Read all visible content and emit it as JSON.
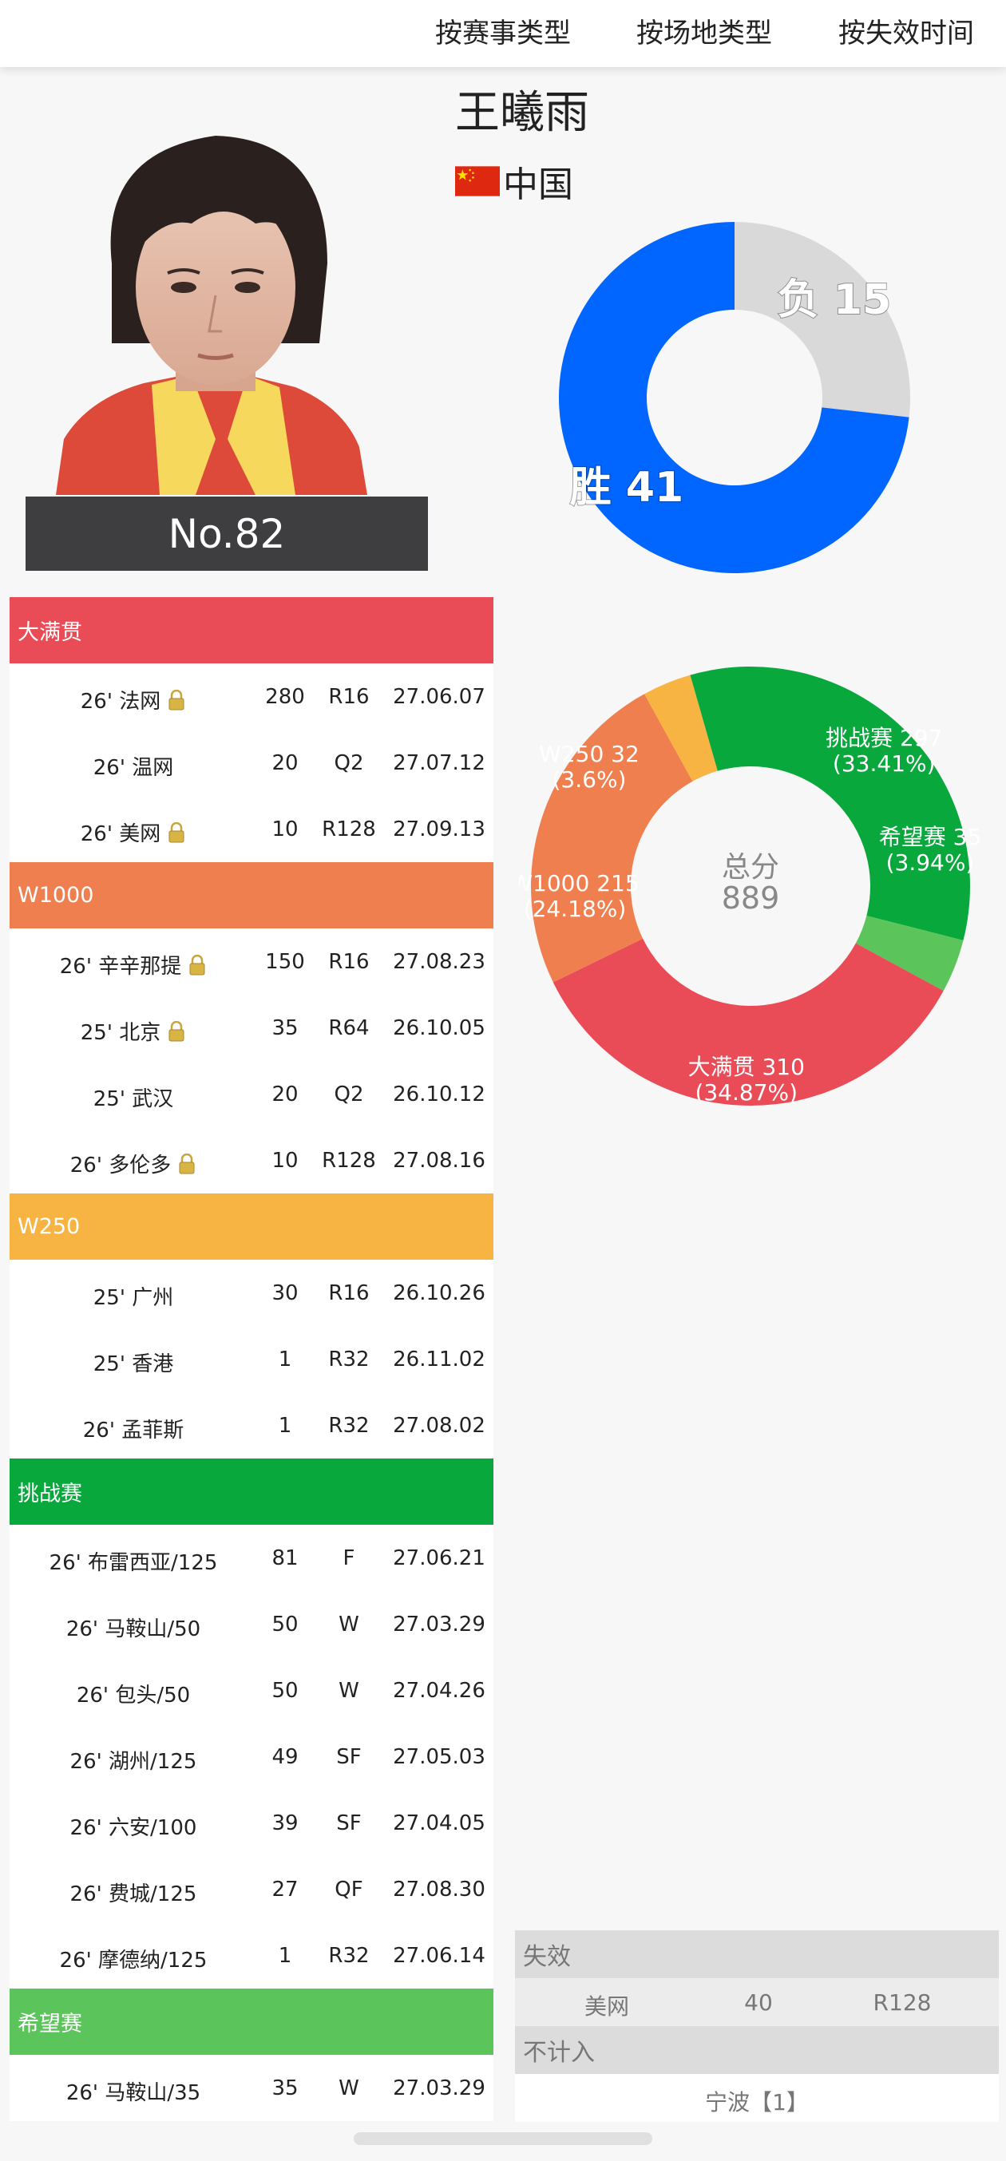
{
  "tabs": [
    "按赛事类型",
    "按场地类型",
    "按失效时间"
  ],
  "player": {
    "name": "王曦雨",
    "country": "中国",
    "rank": "No.82"
  },
  "win_loss": {
    "loss_label": "负 15",
    "win_label": "胜 41",
    "wins": 41,
    "losses": 15,
    "win_color": "#0066ff",
    "loss_color": "#d9d9d9"
  },
  "points_total": {
    "label": "总分",
    "value": "889"
  },
  "chart_data": [
    {
      "type": "pie",
      "categories": [
        "胜",
        "负"
      ],
      "values": [
        41,
        15
      ],
      "colors": [
        "#0066ff",
        "#d9d9d9"
      ]
    },
    {
      "type": "pie",
      "categories": [
        "挑战赛",
        "希望赛",
        "大满贯",
        "W1000",
        "W250"
      ],
      "values": [
        297,
        35,
        310,
        215,
        32
      ],
      "percent_labels": [
        "(33.41%)",
        "(3.94%)",
        "(34.87%)",
        "(24.18%)",
        "(3.6%)"
      ],
      "value_labels": [
        "挑战赛 297",
        "希望赛 35",
        "大满贯 310",
        "W1000 215",
        "W250 32"
      ],
      "colors": [
        "#09a83d",
        "#5bc45b",
        "#e94b57",
        "#f07f50",
        "#f8b442"
      ],
      "center_label": "总分",
      "center_value": "889"
    }
  ],
  "categories": [
    {
      "name": "大满贯",
      "color": "#e94b57",
      "rows": [
        {
          "event": "26' 法网",
          "locked": true,
          "points": "280",
          "round": "R16",
          "date": "27.06.07"
        },
        {
          "event": "26' 温网",
          "locked": false,
          "points": "20",
          "round": "Q2",
          "date": "27.07.12"
        },
        {
          "event": "26' 美网",
          "locked": true,
          "points": "10",
          "round": "R128",
          "date": "27.09.13"
        }
      ]
    },
    {
      "name": "W1000",
      "color": "#f07f50",
      "rows": [
        {
          "event": "26' 辛辛那提",
          "locked": true,
          "points": "150",
          "round": "R16",
          "date": "27.08.23"
        },
        {
          "event": "25' 北京",
          "locked": true,
          "points": "35",
          "round": "R64",
          "date": "26.10.05"
        },
        {
          "event": "25' 武汉",
          "locked": false,
          "points": "20",
          "round": "Q2",
          "date": "26.10.12"
        },
        {
          "event": "26' 多伦多",
          "locked": true,
          "points": "10",
          "round": "R128",
          "date": "27.08.16"
        }
      ]
    },
    {
      "name": "W250",
      "color": "#f8b442",
      "rows": [
        {
          "event": "25' 广州",
          "locked": false,
          "points": "30",
          "round": "R16",
          "date": "26.10.26"
        },
        {
          "event": "25' 香港",
          "locked": false,
          "points": "1",
          "round": "R32",
          "date": "26.11.02"
        },
        {
          "event": "26' 孟菲斯",
          "locked": false,
          "points": "1",
          "round": "R32",
          "date": "27.08.02"
        }
      ]
    },
    {
      "name": "挑战赛",
      "color": "#09a83d",
      "rows": [
        {
          "event": "26' 布雷西亚/125",
          "locked": false,
          "points": "81",
          "round": "F",
          "date": "27.06.21"
        },
        {
          "event": "26' 马鞍山/50",
          "locked": false,
          "points": "50",
          "round": "W",
          "date": "27.03.29"
        },
        {
          "event": "26' 包头/50",
          "locked": false,
          "points": "50",
          "round": "W",
          "date": "27.04.26"
        },
        {
          "event": "26' 湖州/125",
          "locked": false,
          "points": "49",
          "round": "SF",
          "date": "27.05.03"
        },
        {
          "event": "26' 六安/100",
          "locked": false,
          "points": "39",
          "round": "SF",
          "date": "27.04.05"
        },
        {
          "event": "26' 费城/125",
          "locked": false,
          "points": "27",
          "round": "QF",
          "date": "27.08.30"
        },
        {
          "event": "26' 摩德纳/125",
          "locked": false,
          "points": "1",
          "round": "R32",
          "date": "27.06.14"
        }
      ]
    },
    {
      "name": "希望赛",
      "color": "#5bc45b",
      "rows": [
        {
          "event": "26' 马鞍山/35",
          "locked": false,
          "points": "35",
          "round": "W",
          "date": "27.03.29"
        }
      ]
    }
  ],
  "expired": {
    "label": "失效",
    "rows": [
      {
        "event": "美网",
        "points": "40",
        "round": "R128"
      }
    ]
  },
  "not_counted": {
    "label": "不计入",
    "rows": [
      "宁波【1】"
    ]
  }
}
